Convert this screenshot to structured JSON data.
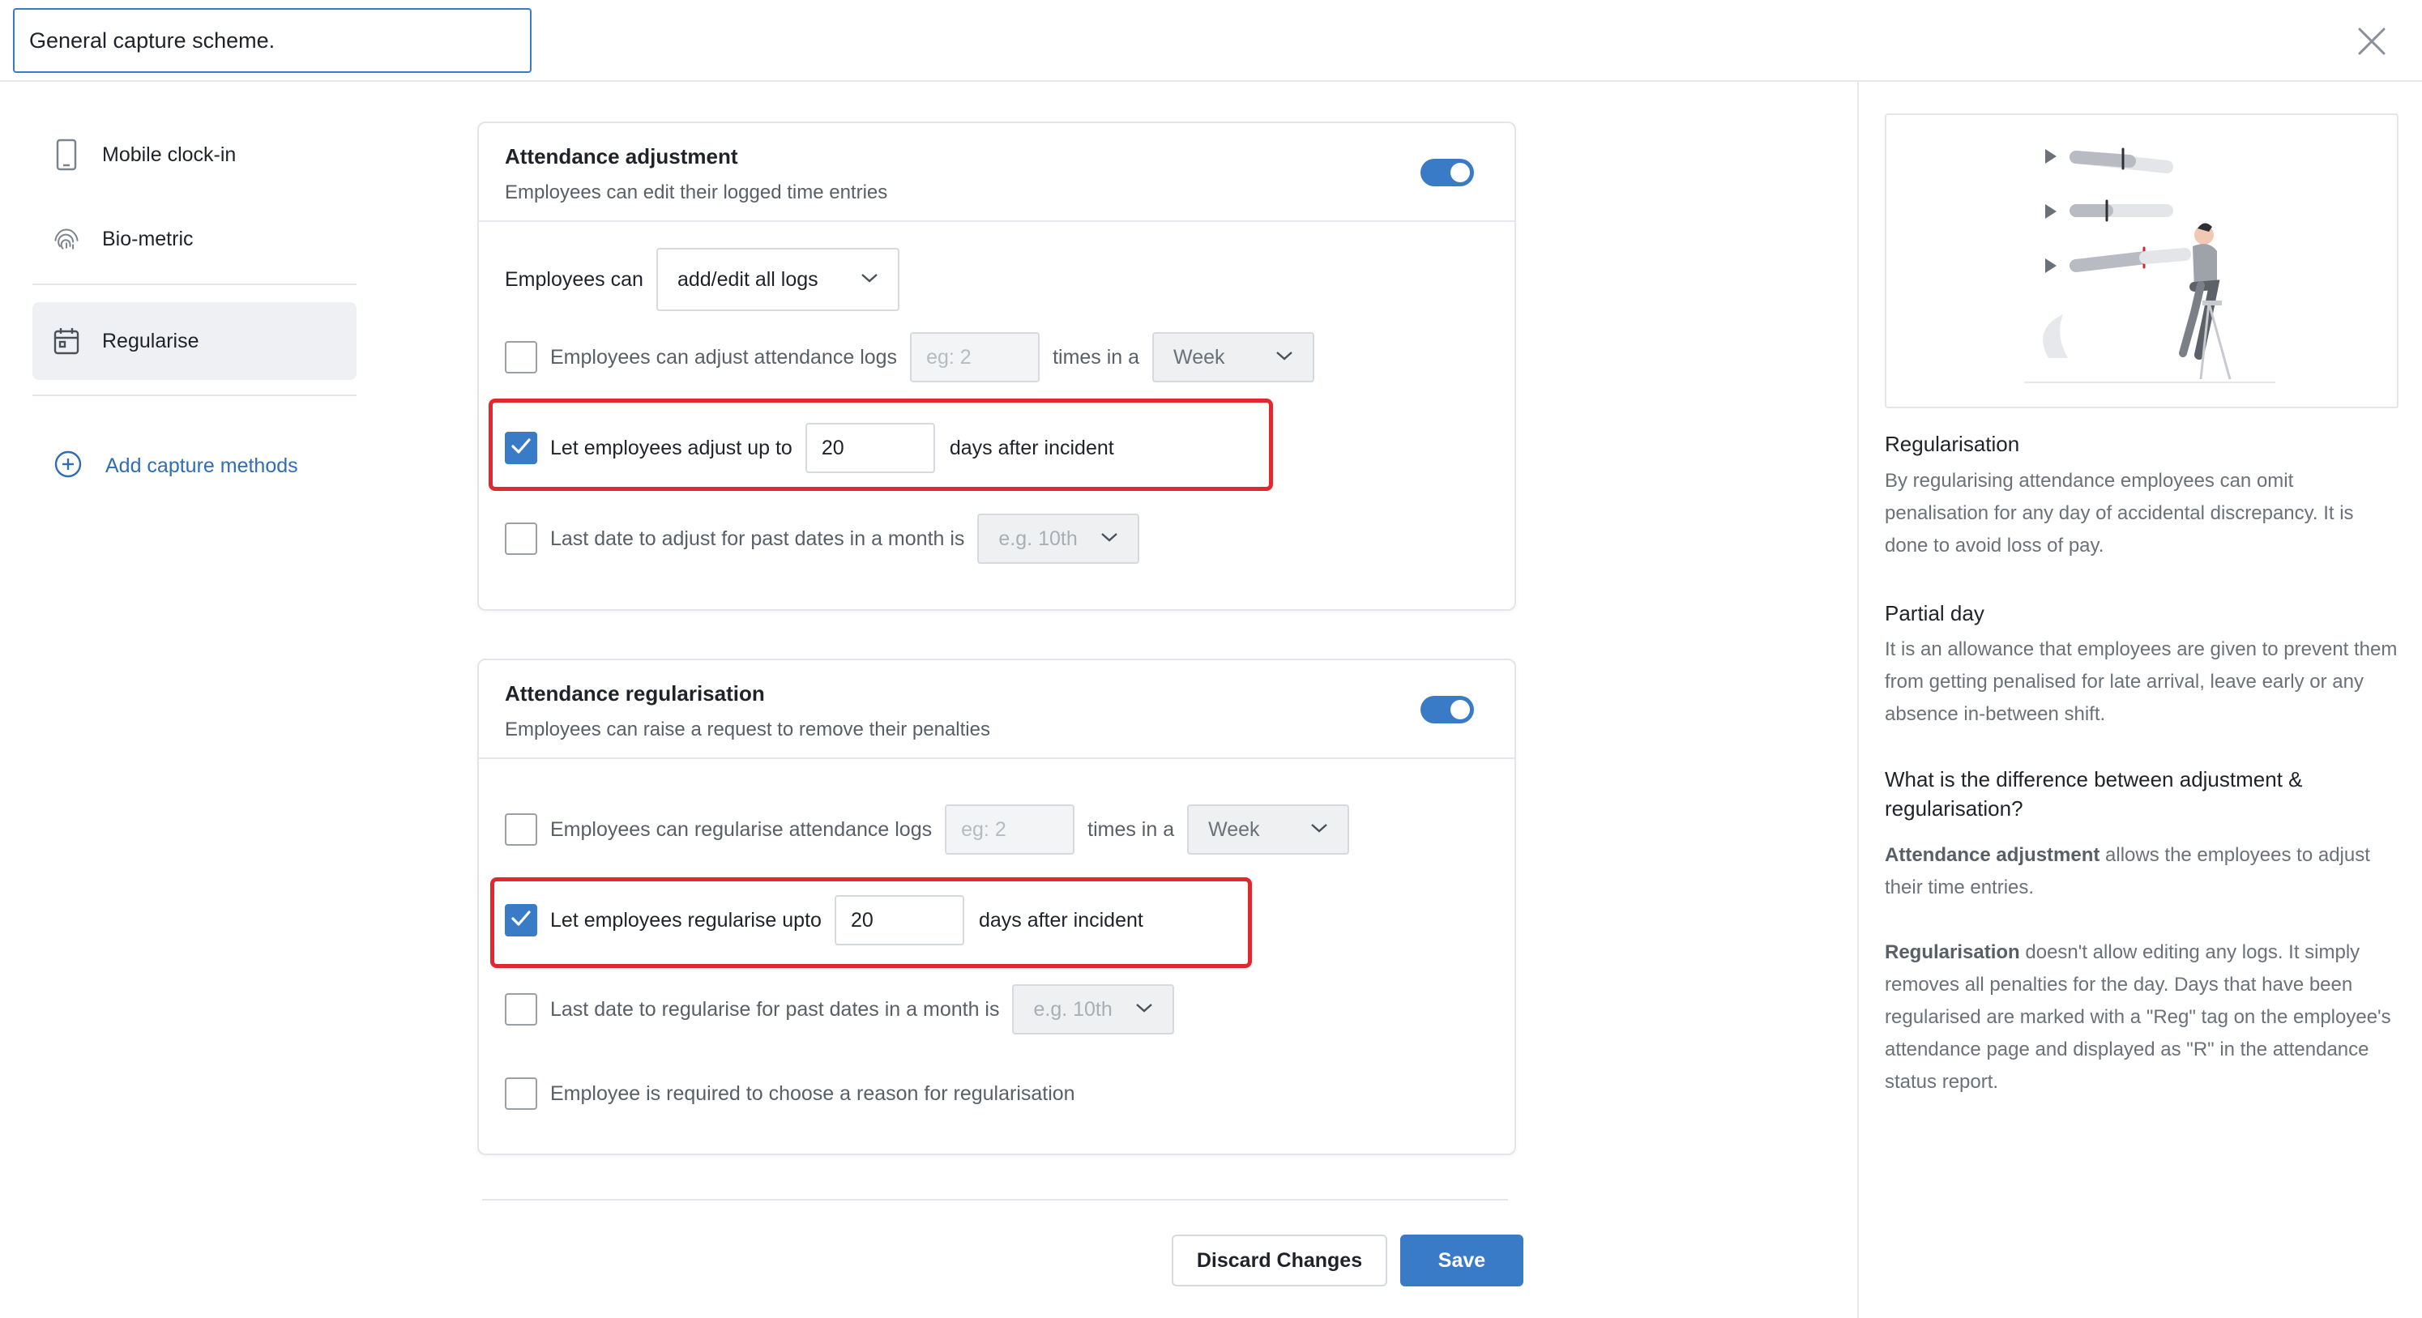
{
  "header": {
    "scheme_name_value": "General capture scheme."
  },
  "sidebar": {
    "items": [
      {
        "label": "Mobile clock-in",
        "icon": "mobile-icon"
      },
      {
        "label": "Bio-metric",
        "icon": "fingerprint-icon"
      },
      {
        "label": "Regularise",
        "icon": "calendar-icon",
        "active": true
      }
    ],
    "add_label": "Add capture methods"
  },
  "adjustment": {
    "title": "Attendance adjustment",
    "subtitle": "Employees can edit their logged time entries",
    "enabled": true,
    "employees_can_label": "Employees can",
    "employees_can_value": "add/edit all logs",
    "limit_label": "Employees can adjust attendance logs",
    "limit_placeholder": "eg: 2",
    "times_in_a": "times in a",
    "period_value": "Week",
    "days_label": "Let employees adjust up to",
    "days_value": "20",
    "days_suffix": "days after incident",
    "last_date_label": "Last date to adjust for past dates in a month is",
    "last_date_placeholder": "e.g. 10th"
  },
  "regularisation": {
    "title": "Attendance regularisation",
    "subtitle": "Employees can raise a request to remove their penalties",
    "enabled": true,
    "limit_label": "Employees can regularise attendance logs",
    "limit_placeholder": "eg: 2",
    "times_in_a": "times in a",
    "period_value": "Week",
    "days_label": "Let employees regularise upto",
    "days_value": "20",
    "days_suffix": "days after incident",
    "last_date_label": "Last date to regularise for past dates in a month is",
    "last_date_placeholder": "e.g. 10th",
    "reason_label": "Employee is required to choose a reason for regularisation"
  },
  "footer": {
    "discard_label": "Discard Changes",
    "save_label": "Save"
  },
  "help": {
    "regularisation_title": "Regularisation",
    "regularisation_body": "By regularising attendance employees can omit penalisation for any day of accidental discrepancy. It is done to avoid loss of pay.",
    "partial_title": "Partial day",
    "partial_body": "It is an allowance that employees are given to prevent them from getting penalised for late arrival, leave early or any absence in-between shift.",
    "diff_title": "What is the difference between adjustment & regularisation?",
    "diff_adjust_bold": "Attendance adjustment",
    "diff_adjust_rest": " allows the employees to adjust their time entries.",
    "diff_reg_bold": "Regularisation",
    "diff_reg_rest": " doesn't allow editing any logs. It simply removes all penalties for the day. Days that have been regularised are marked with a \"Reg\" tag on the employee's attendance page and displayed as \"R\" in the attendance status report."
  },
  "colors": {
    "accent": "#3a7bc8",
    "highlight": "#e0282e",
    "link": "#2f6db5"
  }
}
